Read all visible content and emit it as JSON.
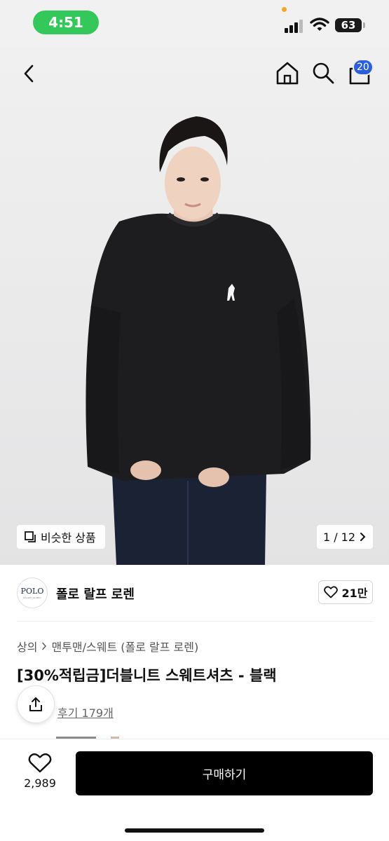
{
  "status_bar": {
    "time": "4:51",
    "battery": "63"
  },
  "header": {
    "cart_count": "20"
  },
  "gallery": {
    "similar_label": "비슷한 상품",
    "counter": "1 / 12"
  },
  "brand": {
    "logo_text": "POLO",
    "logo_subtext": "RALPH LAUREN",
    "name": "폴로 랄프 로렌",
    "likes": "21만"
  },
  "breadcrumb": {
    "level1": "상의",
    "level2": "맨투맨/스웨트 (폴로 랄프 로렌)"
  },
  "product": {
    "title": "[30%적립금]더블니트 스웨트셔츠 - 블랙",
    "reviews": "후기 179개"
  },
  "bottom_bar": {
    "wish_count": "2,989",
    "buy_label": "구매하기"
  },
  "colors": {
    "status_pill": "#34c759",
    "badge": "#2c5fdb",
    "buy_button": "#000000",
    "sweatshirt": "#1c1c1e"
  },
  "icons": [
    "back-icon",
    "home-icon",
    "search-icon",
    "cart-icon",
    "similar-icon",
    "chevron-right-icon",
    "heart-icon",
    "share-icon"
  ]
}
